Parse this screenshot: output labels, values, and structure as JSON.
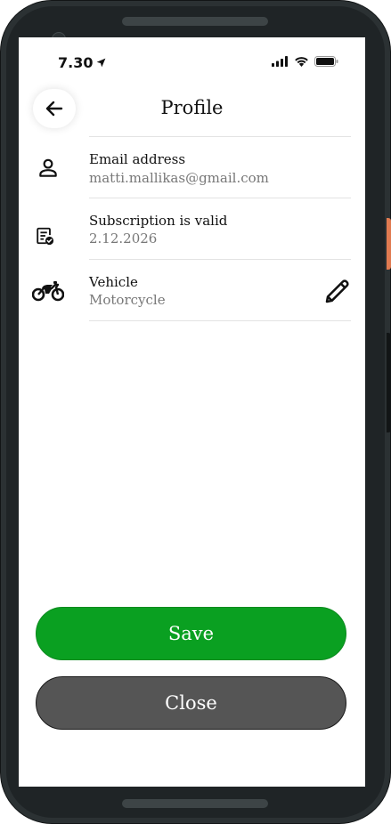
{
  "status_bar": {
    "time": "7.30"
  },
  "header": {
    "title": "Profile"
  },
  "profile_rows": [
    {
      "title": "Email address",
      "value": "matti.mallikas@gmail.com",
      "icon": "person-icon"
    },
    {
      "title": "Subscription is valid",
      "value": "2.12.2026",
      "icon": "subscription-icon"
    },
    {
      "title": "Vehicle",
      "value": "Motorcycle",
      "icon": "motorcycle-icon",
      "editable": true
    }
  ],
  "actions": {
    "save_label": "Save",
    "close_label": "Close"
  },
  "colors": {
    "save": "#0aa021",
    "close": "#555555",
    "phone_frame": "#2b3133"
  }
}
